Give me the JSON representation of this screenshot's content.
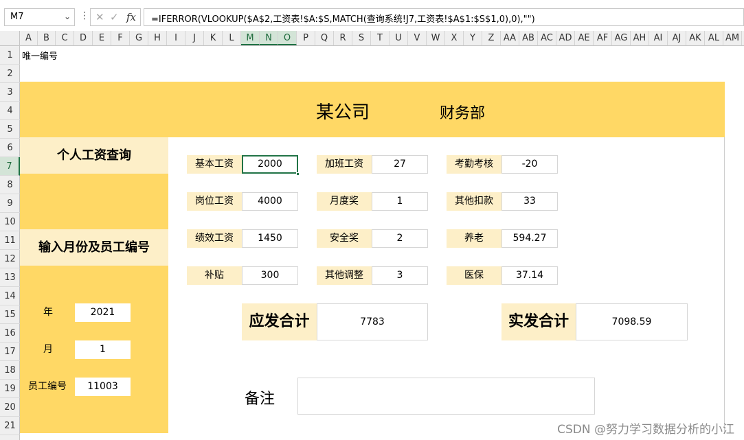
{
  "formula_bar": {
    "name_box": "M7",
    "formula": "=IFERROR(VLOOKUP($A$2,工资表!$A:$S,MATCH(查询系统!J7,工资表!$A$1:$S$1,0),0),\"\")"
  },
  "columns": [
    "A",
    "B",
    "C",
    "D",
    "E",
    "F",
    "G",
    "H",
    "I",
    "J",
    "K",
    "L",
    "M",
    "N",
    "O",
    "P",
    "Q",
    "R",
    "S",
    "T",
    "U",
    "V",
    "W",
    "X",
    "Y",
    "Z",
    "AA",
    "AB",
    "AC",
    "AD",
    "AE",
    "AF",
    "AG",
    "AH",
    "AI",
    "AJ",
    "AK",
    "AL",
    "AM"
  ],
  "rows": [
    "1",
    "2",
    "3",
    "4",
    "5",
    "6",
    "7",
    "8",
    "9",
    "10",
    "11",
    "12",
    "13",
    "14",
    "15",
    "16",
    "17",
    "18",
    "19",
    "20",
    "21"
  ],
  "a1_text": "唯一编号",
  "header": {
    "company": "某公司",
    "department": "财务部"
  },
  "left_panel": {
    "title": "个人工资查询",
    "input_title": "输入月份及员工编号",
    "year_label": "年",
    "year_value": "2021",
    "month_label": "月",
    "month_value": "1",
    "emp_label": "员工编号",
    "emp_value": "11003"
  },
  "fields": [
    {
      "label": "基本工资",
      "value": "2000"
    },
    {
      "label": "加班工资",
      "value": "27"
    },
    {
      "label": "考勤考核",
      "value": "-20"
    },
    {
      "label": "岗位工资",
      "value": "4000"
    },
    {
      "label": "月度奖",
      "value": "1"
    },
    {
      "label": "其他扣款",
      "value": "33"
    },
    {
      "label": "绩效工资",
      "value": "1450"
    },
    {
      "label": "安全奖",
      "value": "2"
    },
    {
      "label": "养老",
      "value": "594.27"
    },
    {
      "label": "补贴",
      "value": "300"
    },
    {
      "label": "其他调整",
      "value": "3"
    },
    {
      "label": "医保",
      "value": "37.14"
    }
  ],
  "totals": {
    "gross_label": "应发合计",
    "gross_value": "7783",
    "net_label": "实发合计",
    "net_value": "7098.59"
  },
  "note_label": "备注",
  "watermark": "CSDN @努力学习数据分析的小江",
  "colors": {
    "accent_yellow": "#ffd865",
    "light_yellow": "#fdefc8",
    "excel_green": "#217346"
  }
}
